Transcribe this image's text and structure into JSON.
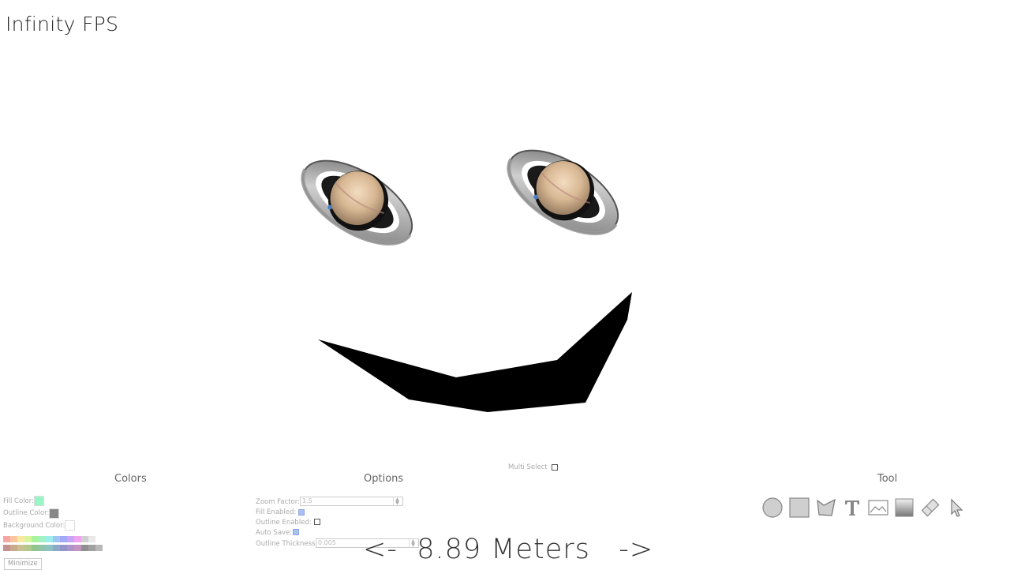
{
  "app": {
    "title": "Infinity FPS"
  },
  "canvas": {
    "planet_icon": "saturn-image",
    "mouth_color": "#000000"
  },
  "multi_select": {
    "label": "Multi Select",
    "checked": false
  },
  "colors_panel": {
    "title": "Colors",
    "fill_label": "Fill Color:",
    "fill_color": "#99f5c6",
    "outline_label": "Outline Color:",
    "outline_color": "#888888",
    "background_label": "Background Color:",
    "background_color": "#ffffff",
    "palette_row1": [
      "#f7a6a6",
      "#f9c6a0",
      "#f7eaa0",
      "#d9f59c",
      "#a9f39e",
      "#9ef3c6",
      "#9cecec",
      "#9fc7f5",
      "#a4a8f7",
      "#c7a4f5",
      "#f0a4f0",
      "#d0d0d0",
      "#e8e8e8"
    ],
    "palette_row2": [
      "#c49090",
      "#c8aa8e",
      "#c8c08e",
      "#b2c88e",
      "#94c48e",
      "#8ec4a8",
      "#8ec2c2",
      "#8ea8c8",
      "#9494c8",
      "#ae94c8",
      "#c494c4",
      "#909090",
      "#a0a0a0",
      "#b8b8b8"
    ],
    "minimize_label": "Minimize"
  },
  "options_panel": {
    "title": "Options",
    "zoom_label": "Zoom Factor:",
    "zoom_value": "1.5",
    "fill_enabled_label": "Fill Enabled:",
    "fill_enabled": true,
    "outline_enabled_label": "Outline Enabled:",
    "outline_enabled": false,
    "auto_save_label": "Auto Save:",
    "auto_save": true,
    "outline_thickness_label": "Outline Thickness:",
    "outline_thickness_value": "0.005"
  },
  "tool_panel": {
    "title": "Tool",
    "tools": [
      "circle-tool-icon",
      "rectangle-tool-icon",
      "polygon-tool-icon",
      "text-tool-icon",
      "image-tool-icon",
      "gradient-tool-icon",
      "eraser-tool-icon",
      "select-tool-icon"
    ]
  },
  "navigation": {
    "prev_label": "<-",
    "distance": "8.89 Meters",
    "next_label": "->"
  }
}
